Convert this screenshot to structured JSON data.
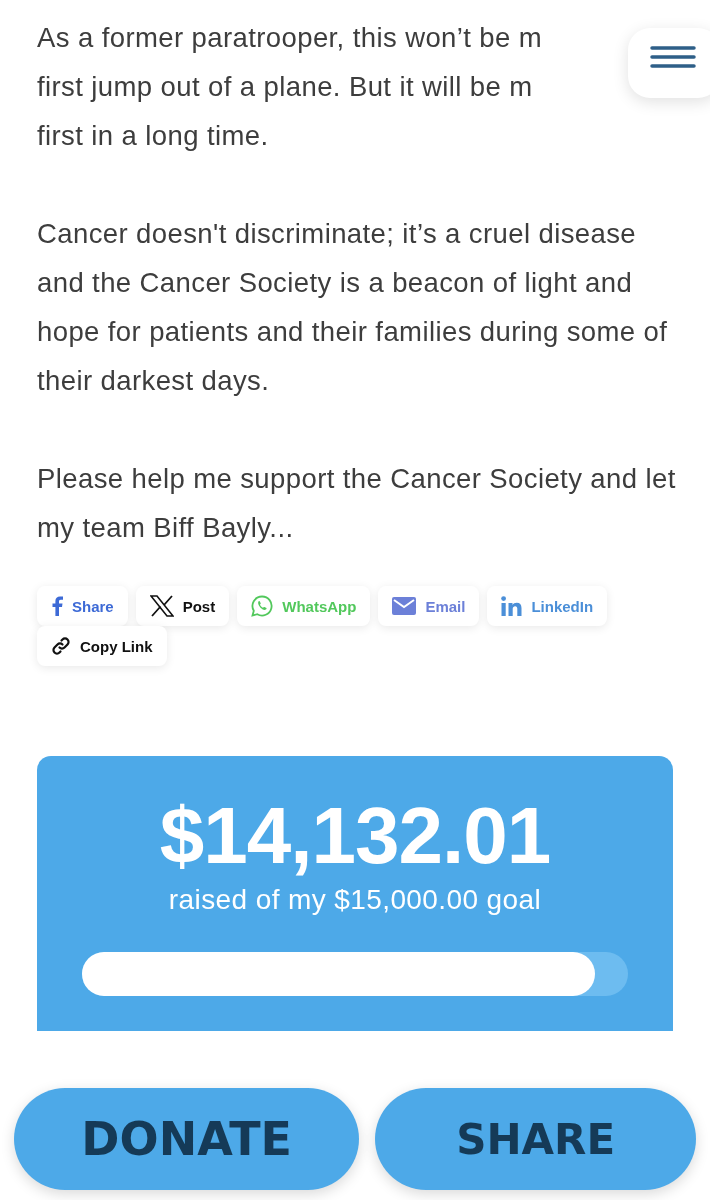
{
  "story": {
    "cut_paragraph_lines": [
      "As a former paratrooper, this won’t be m",
      "first jump out of a plane. But it will be m",
      "first in a long time."
    ],
    "paragraphs": [
      "Cancer doesn't discriminate; it’s a cruel disease and the Cancer Society is a beacon of light and hope for patients and their families during some of their darkest days.",
      "Please help me support the Cancer Society and let my team Biff Bayly..."
    ]
  },
  "share_links": [
    {
      "kind": "facebook",
      "label": "Share",
      "color": "#3d6ad6"
    },
    {
      "kind": "x",
      "label": "Post",
      "color": "#111111"
    },
    {
      "kind": "whatsapp",
      "label": "WhatsApp",
      "color": "#52c85c"
    },
    {
      "kind": "email",
      "label": "Email",
      "color": "#6c80d8"
    },
    {
      "kind": "linkedin",
      "label": "LinkedIn",
      "color": "#4b8fd8"
    },
    {
      "kind": "link",
      "label": "Copy Link",
      "color": "#111111"
    }
  ],
  "fundraising": {
    "amount": "$14,132.01",
    "caption": "raised of my $15,000.00 goal",
    "level": 0.94
  },
  "actions": [
    "DONATE",
    "SHARE"
  ]
}
